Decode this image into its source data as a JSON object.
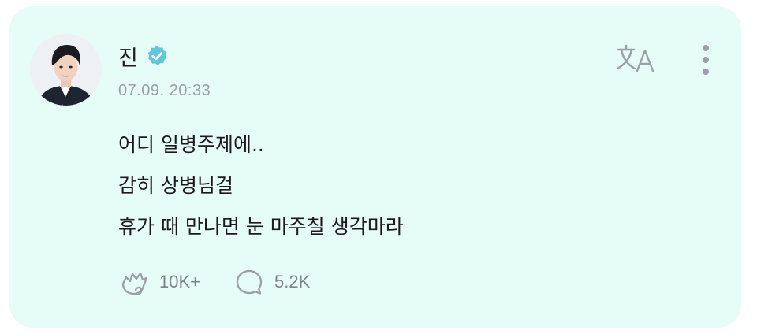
{
  "post": {
    "author": {
      "name": "진",
      "verified": true,
      "verified_color": "#5cc8e0",
      "avatar_icon": "profile-photo",
      "badge_icon": "star-icon"
    },
    "timestamp": "07.09. 20:33",
    "body_lines": [
      "어디 일병주제에..",
      "감히 상병님걸",
      "휴가 때 만나면 눈 마주칠 생각마라"
    ],
    "actions": {
      "like": {
        "icon": "cheer-hands-icon",
        "count": "10K+"
      },
      "comment": {
        "icon": "comment-bubble-icon",
        "count": "5.2K"
      }
    },
    "toolbar": {
      "translate_icon": "translate-icon",
      "more_icon": "more-vertical-icon"
    }
  },
  "colors": {
    "card_background": "#e6fcf7",
    "text_primary": "#1a1a1a",
    "text_secondary": "#9aa0a6",
    "icon_gray": "#9aa0a6"
  }
}
